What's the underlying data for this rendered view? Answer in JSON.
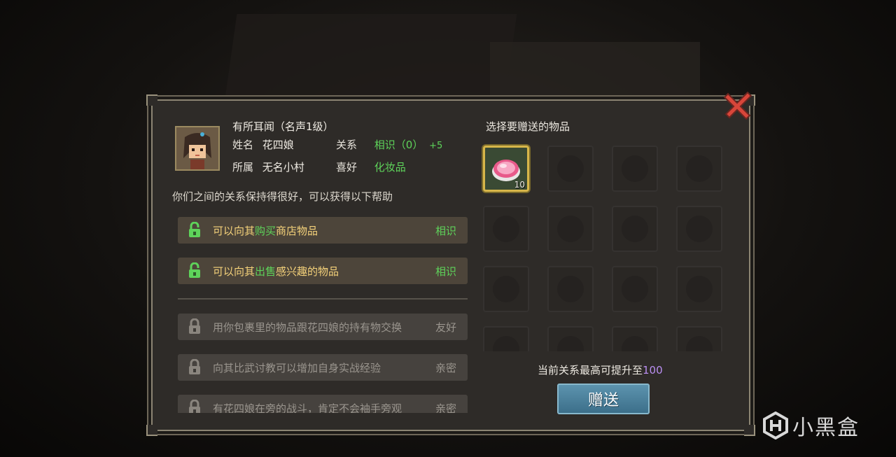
{
  "npc": {
    "reputation_title": "有所耳闻（名声1级）",
    "name_label": "姓名",
    "name_value": "花四娘",
    "belong_label": "所属",
    "belong_value": "无名小村",
    "relation_label": "关系",
    "relation_value": "相识（0）",
    "relation_bonus": "+5",
    "likes_label": "喜好",
    "likes_value": "化妆品"
  },
  "relation_desc": "你们之间的关系保持得很好，可以获得以下帮助",
  "perks": [
    {
      "pre": "可以向其",
      "hl": "购买",
      "post": "商店物品",
      "level": "相识",
      "locked": false
    },
    {
      "pre": "可以向其",
      "hl": "出售",
      "post": "感兴趣的物品",
      "level": "相识",
      "locked": false
    },
    {
      "pre": "用你包裹里的物品跟花四娘的持有物交换",
      "hl": "",
      "post": "",
      "level": "友好",
      "locked": true
    },
    {
      "pre": "向其比武讨教可以增加自身实战经验",
      "hl": "",
      "post": "",
      "level": "亲密",
      "locked": true
    },
    {
      "pre": "有花四娘在旁的战斗，肯定不会袖手旁观",
      "hl": "",
      "post": "",
      "level": "亲密",
      "locked": true
    }
  ],
  "gift": {
    "title": "选择要赠送的物品",
    "item_count": "10",
    "max_text": "当前关系最高可提升至",
    "max_value": "100",
    "button_label": "赠送"
  },
  "watermark": "小黑盒",
  "colors": {
    "panel_bg": "#2e2b28",
    "panel_border": "#8c8573",
    "green": "#5ed35a",
    "gold": "#f5d27a",
    "purple": "#b98ef0",
    "button": "#4c83a0"
  }
}
